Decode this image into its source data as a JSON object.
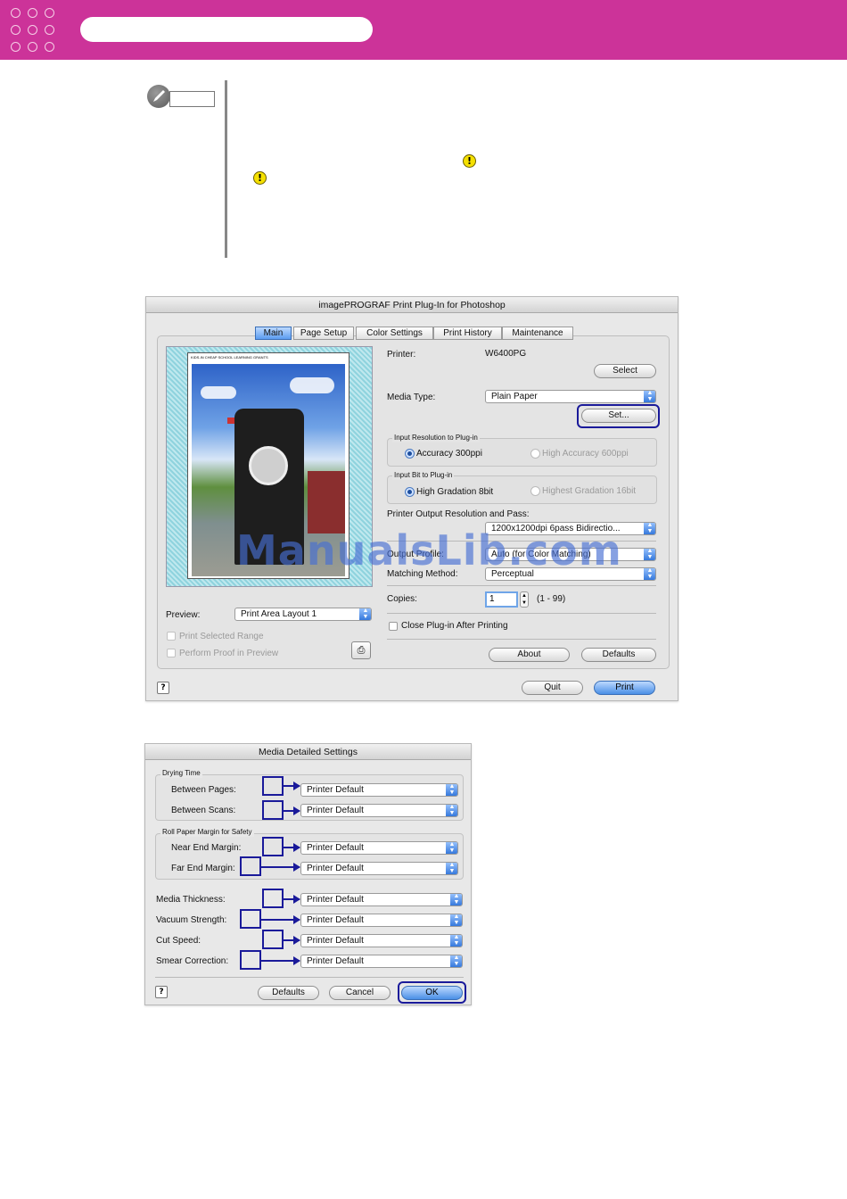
{
  "header": {
    "band_color": "#cc3399"
  },
  "main_dialog": {
    "title": "imagePROGRAF Print Plug-In for Photoshop",
    "tabs": [
      {
        "label": "Main",
        "selected": true
      },
      {
        "label": "Page Setup"
      },
      {
        "label": "Color Settings"
      },
      {
        "label": "Print History"
      },
      {
        "label": "Maintenance"
      }
    ],
    "printer_label": "Printer:",
    "printer_value": "W6400PG",
    "select_button": "Select",
    "media_type_label": "Media Type:",
    "media_type_value": "Plain Paper",
    "set_button": "Set...",
    "input_resolution": {
      "legend": "Input Resolution to Plug-in",
      "options": [
        "Accuracy 300ppi",
        "High Accuracy 600ppi"
      ]
    },
    "input_bit": {
      "legend": "Input Bit to Plug-in",
      "options": [
        "High Gradation 8bit",
        "Highest Gradation 16bit"
      ]
    },
    "output_resolution_label": "Printer Output Resolution and Pass:",
    "output_resolution_value": "1200x1200dpi 6pass Bidirectio...",
    "output_profile_label": "Output Profile:",
    "output_profile_value": "Auto (for Color Matching)",
    "matching_method_label": "Matching Method:",
    "matching_method_value": "Perceptual",
    "copies_label": "Copies:",
    "copies_value": "1",
    "copies_range": "(1 - 99)",
    "close_after_printing": "Close Plug-in After Printing",
    "preview_label": "Preview:",
    "preview_value": "Print Area Layout 1",
    "print_selected_range": "Print Selected Range",
    "perform_proof": "Perform Proof in Preview",
    "about_button": "About",
    "defaults_button": "Defaults",
    "quit_button": "Quit",
    "print_button": "Print",
    "preview_caption": "KIDS-IN CHEAP SCHOOL LEARNING GRANTS"
  },
  "watermark": "ManualsLib.com",
  "media_dialog": {
    "title": "Media Detailed Settings",
    "drying_time": {
      "legend": "Drying Time",
      "rows": [
        {
          "label": "Between Pages:",
          "value": "Printer Default"
        },
        {
          "label": "Between Scans:",
          "value": "Printer Default"
        }
      ]
    },
    "roll_margin": {
      "legend": "Roll Paper Margin for Safety",
      "rows": [
        {
          "label": "Near End Margin:",
          "value": "Printer Default"
        },
        {
          "label": "Far End Margin:",
          "value": "Printer Default"
        }
      ]
    },
    "rows": [
      {
        "label": "Media Thickness:",
        "value": "Printer Default"
      },
      {
        "label": "Vacuum Strength:",
        "value": "Printer Default"
      },
      {
        "label": "Cut Speed:",
        "value": "Printer Default"
      },
      {
        "label": "Smear Correction:",
        "value": "Printer Default"
      }
    ],
    "defaults_button": "Defaults",
    "cancel_button": "Cancel",
    "ok_button": "OK"
  },
  "icons": [
    "pencil-note-icon",
    "warning-icon",
    "help-icon",
    "proof-icon"
  ],
  "colors": {
    "accent_blue": "#1a1a9a",
    "warning_yellow": "#f5e000"
  }
}
